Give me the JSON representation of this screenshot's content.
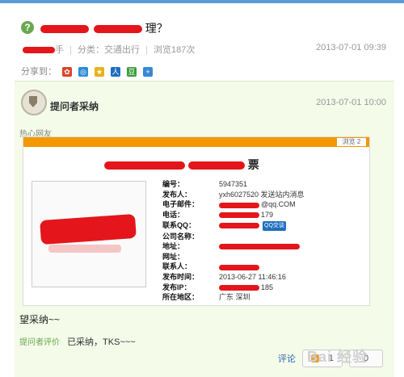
{
  "question": {
    "title_suffix": "理？",
    "meta": {
      "author_tail": "手",
      "category": "分类：交通出行",
      "views": "浏览187次",
      "date": "2013-07-01 09:39"
    },
    "share_label": "分享到：",
    "share_icons": [
      "sina-weibo-icon",
      "qzone-icon",
      "star-icon",
      "renren-icon",
      "douban-icon",
      "plus-icon"
    ]
  },
  "answer": {
    "adopt_label": "提问者采纳",
    "date": "2013-07-01 10:00",
    "hot_label": "热心网友",
    "screenshot": {
      "title_suffix": "票",
      "bar_right": "浏览 2",
      "fields": [
        {
          "key": "编号：",
          "value": "5947351"
        },
        {
          "key": "发布人：",
          "value": "yxh6027520  发送站内消息"
        },
        {
          "key": "电子邮件：",
          "value": "@qq.COM"
        },
        {
          "key": "电话：",
          "value": "179"
        },
        {
          "key": "联系QQ：",
          "value": "",
          "badge": "QQ交谈"
        },
        {
          "key": "公司名称：",
          "value": ""
        },
        {
          "key": "地址：",
          "value": ""
        },
        {
          "key": "网址：",
          "value": ""
        },
        {
          "key": "联系人：",
          "value": ""
        },
        {
          "key": "发布时间：",
          "value": "2013-06-27 11:46:16"
        },
        {
          "key": "发布IP：",
          "value": "185"
        },
        {
          "key": "所在地区：",
          "value": "广东 深圳"
        }
      ]
    },
    "reply_text": "望采纳~~",
    "evaluation": {
      "label": "提问者评价",
      "text": "已采纳，TKS~~~"
    },
    "actions": {
      "comment": "评论",
      "vote_count": "1",
      "share_short": "0"
    }
  },
  "watermark": "Bai 经验",
  "colors": {
    "accent_green": "#6aa84f",
    "answer_bg": "#f4fbe9",
    "redact": "#e4161b",
    "orange_bar": "#f39800"
  }
}
